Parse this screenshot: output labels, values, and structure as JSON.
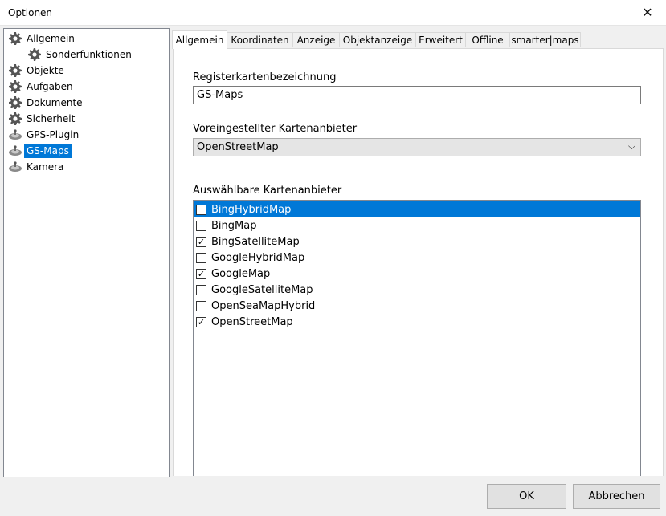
{
  "window": {
    "title": "Optionen",
    "close_icon": "close-icon"
  },
  "tree": {
    "items": [
      {
        "label": "Allgemein",
        "icon": "gear-icon",
        "level": 0,
        "selected": false
      },
      {
        "label": "Sonderfunktionen",
        "icon": "gear-icon",
        "level": 1,
        "selected": false
      },
      {
        "label": "Objekte",
        "icon": "gear-icon",
        "level": 0,
        "selected": false
      },
      {
        "label": "Aufgaben",
        "icon": "gear-icon",
        "level": 0,
        "selected": false
      },
      {
        "label": "Dokumente",
        "icon": "gear-icon",
        "level": 0,
        "selected": false
      },
      {
        "label": "Sicherheit",
        "icon": "gear-icon",
        "level": 0,
        "selected": false
      },
      {
        "label": "GPS-Plugin",
        "icon": "satellite-icon",
        "level": 0,
        "selected": false
      },
      {
        "label": "GS-Maps",
        "icon": "satellite-icon",
        "level": 0,
        "selected": true
      },
      {
        "label": "Kamera",
        "icon": "satellite-icon",
        "level": 0,
        "selected": false
      }
    ]
  },
  "tabs": [
    {
      "label": "Allgemein",
      "active": true
    },
    {
      "label": "Koordinaten",
      "active": false
    },
    {
      "label": "Anzeige",
      "active": false
    },
    {
      "label": "Objektanzeige",
      "active": false
    },
    {
      "label": "Erweitert",
      "active": false
    },
    {
      "label": "Offline",
      "active": false
    },
    {
      "label": "smarter|maps",
      "active": false
    }
  ],
  "form": {
    "tab_name_label": "Registerkartenbezeichnung",
    "tab_name_value": "GS-Maps",
    "default_provider_label": "Voreingestellter Kartenanbieter",
    "default_provider_value": "OpenStreetMap",
    "providers_label": "Auswählbare Kartenanbieter",
    "providers": [
      {
        "name": "BingHybridMap",
        "checked": false,
        "selected": true
      },
      {
        "name": "BingMap",
        "checked": false,
        "selected": false
      },
      {
        "name": "BingSatelliteMap",
        "checked": true,
        "selected": false
      },
      {
        "name": "GoogleHybridMap",
        "checked": false,
        "selected": false
      },
      {
        "name": "GoogleMap",
        "checked": true,
        "selected": false
      },
      {
        "name": "GoogleSatelliteMap",
        "checked": false,
        "selected": false
      },
      {
        "name": "OpenSeaMapHybrid",
        "checked": false,
        "selected": false
      },
      {
        "name": "OpenStreetMap",
        "checked": true,
        "selected": false
      }
    ]
  },
  "buttons": {
    "ok_label": "OK",
    "cancel_label": "Abbrechen"
  },
  "colors": {
    "selection": "#0078d7",
    "window_bg": "#f0f0f0"
  }
}
